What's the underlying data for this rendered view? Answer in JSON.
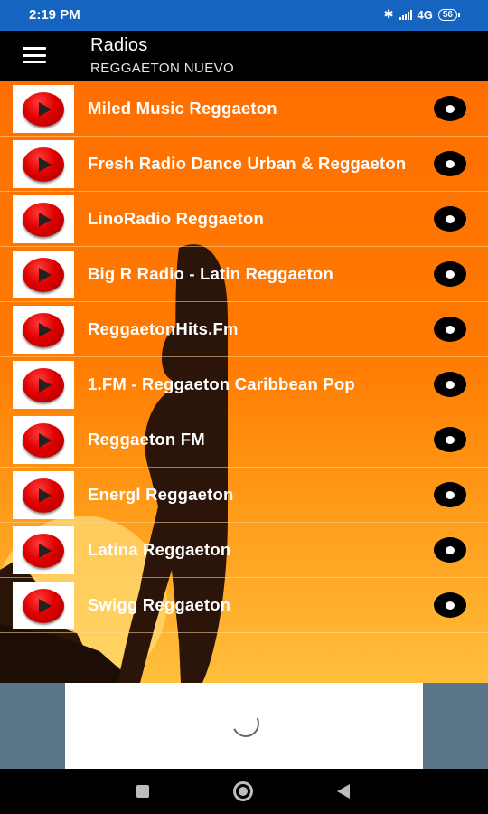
{
  "status_bar": {
    "time": "2:19 PM",
    "network": "4G",
    "battery": "56"
  },
  "app_bar": {
    "title": "Radios",
    "subtitle": "REGGAETON NUEVO"
  },
  "stations": [
    {
      "name": "Miled Music Reggaeton"
    },
    {
      "name": "Fresh Radio Dance Urban & Reggaeton"
    },
    {
      "name": "LinoRadio Reggaeton"
    },
    {
      "name": "Big R Radio - Latin Reggaeton"
    },
    {
      "name": "ReggaetonHits.Fm"
    },
    {
      "name": "1.FM - Reggaeton Caribbean Pop"
    },
    {
      "name": "Reggaeton FM"
    },
    {
      "name": "Energl Reggaeton"
    },
    {
      "name": "Latina Reggaeton"
    },
    {
      "name": "Swigg Reggaeton"
    }
  ],
  "colors": {
    "status_bar": "#1565c0",
    "app_bar": "#000000",
    "list_background": "#ff6f00",
    "ad_area": "#5b7689"
  },
  "icons": {
    "menu": "menu-icon",
    "station_thumb": "play-icon",
    "row_action": "more-icon",
    "nav": [
      "recents-icon",
      "home-icon",
      "back-icon"
    ]
  }
}
